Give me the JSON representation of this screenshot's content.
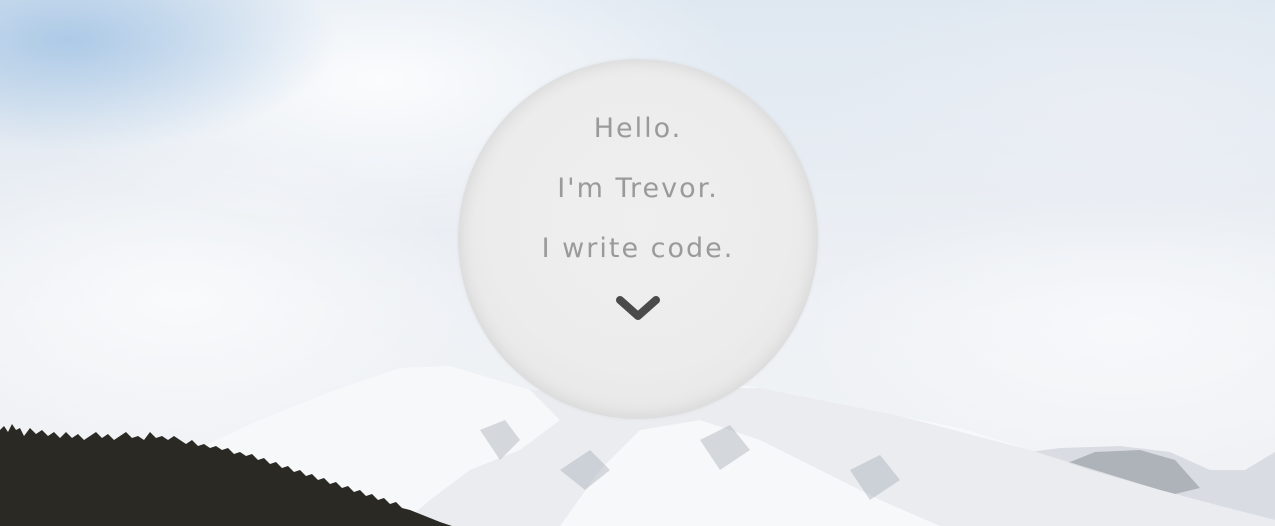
{
  "intro": {
    "greeting": "Hello.",
    "name_line": "I'm Trevor.",
    "tagline": "I write code."
  },
  "scroll_button": {
    "icon": "chevron-down-icon"
  },
  "colors": {
    "text": "#9a9a9a",
    "circle": "#ececec",
    "chevron": "#4a4a4a",
    "tree_silhouette": "#2b2924"
  }
}
